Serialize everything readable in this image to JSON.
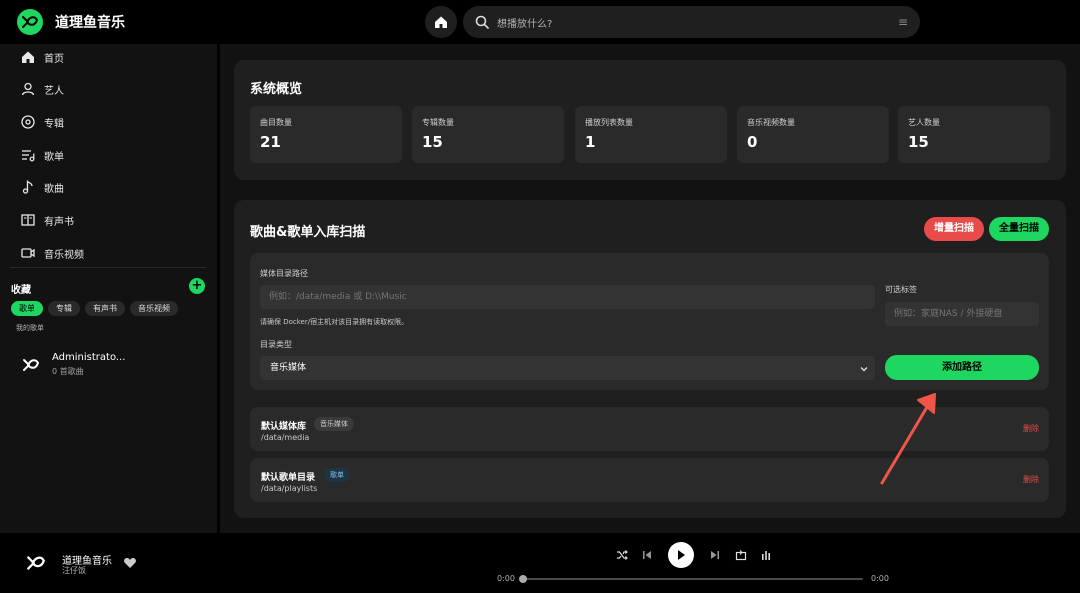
{
  "app": {
    "name": "道理鱼音乐"
  },
  "search": {
    "placeholder": "想播放什么?"
  },
  "sidebar": {
    "nav": [
      {
        "label": "首页",
        "icon": "home-icon"
      },
      {
        "label": "艺人",
        "icon": "person-icon"
      },
      {
        "label": "专辑",
        "icon": "disc-icon"
      },
      {
        "label": "歌单",
        "icon": "playlist-icon"
      },
      {
        "label": "歌曲",
        "icon": "music-note-icon"
      },
      {
        "label": "有声书",
        "icon": "book-icon"
      },
      {
        "label": "音乐视频",
        "icon": "video-icon"
      }
    ],
    "favorites": {
      "title": "收藏",
      "chips": [
        "歌单",
        "专辑",
        "有声书",
        "音乐视频"
      ],
      "active_chip": "歌单",
      "section_label": "我的歌单",
      "playlists": [
        {
          "name": "Administrato...",
          "count": "0 首歌曲"
        }
      ]
    }
  },
  "overview": {
    "title": "系统概览",
    "stats": [
      {
        "label": "曲目数量",
        "value": "21"
      },
      {
        "label": "专辑数量",
        "value": "15"
      },
      {
        "label": "播放列表数量",
        "value": "1"
      },
      {
        "label": "音乐视频数量",
        "value": "0"
      },
      {
        "label": "艺人数量",
        "value": "15"
      }
    ]
  },
  "scan": {
    "title": "歌曲&歌单入库扫描",
    "incremental_label": "增量扫描",
    "full_label": "全量扫描",
    "form": {
      "path_label": "媒体目录路径",
      "path_placeholder": "例如：/data/media 或 D:\\\\Music",
      "hint": "请确保 Docker/宿主机对该目录拥有读取权限。",
      "tag_label": "可选标签",
      "tag_placeholder": "例如：家庭NAS / 外接硬盘",
      "type_label": "目录类型",
      "type_value": "音乐媒体",
      "add_label": "添加路径"
    },
    "paths": [
      {
        "name": "默认媒体库",
        "badge": "音乐媒体",
        "path": "/data/media",
        "delete_label": "删除"
      },
      {
        "name": "默认歌单目录",
        "badge": "歌单",
        "path": "/data/playlists",
        "delete_label": "删除"
      }
    ]
  },
  "player": {
    "title": "道理鱼音乐",
    "artist": "汪仔饭",
    "current_time": "0:00",
    "duration": "0:00",
    "progress": 0
  },
  "colors": {
    "accent": "#1ed760",
    "danger": "#e94b4b",
    "annotation": "#f0554a"
  }
}
